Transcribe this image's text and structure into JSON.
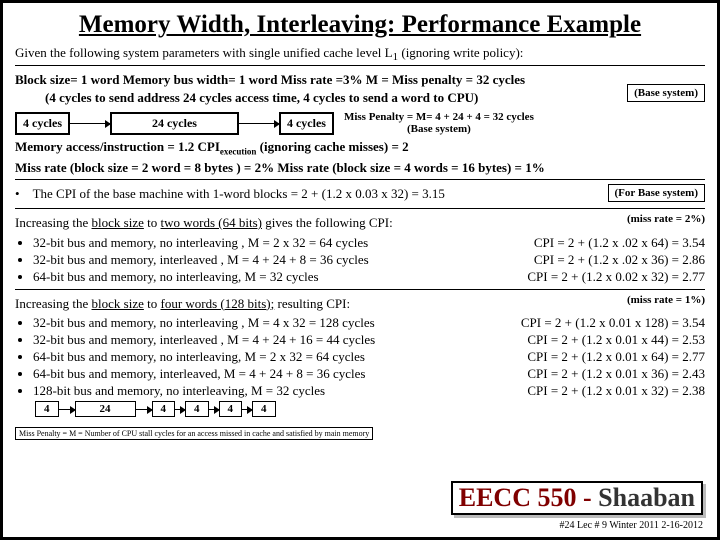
{
  "title": "Memory Width, Interleaving: Performance Example",
  "given": "Given the following system parameters with single unified cache level L",
  "given_sub": "1",
  "given_end": " (ignoring write policy):",
  "params1": "Block size= 1 word   Memory bus width= 1  word    Miss rate =3%   M = Miss penalty = 32 cycles",
  "params2": "(4 cycles to send address       24 cycles  access time,    4 cycles to send a word to CPU)",
  "base_sys": "(Base system)",
  "c4": "4 cycles",
  "c24": "24 cycles",
  "miss_eq": "Miss Penalty = M= 4 + 24 + 4 = 32 cycles",
  "mem_acc": "Memory access/instruction = 1.2         CPI",
  "cpi_sub": "execution",
  "cpi_txt": " (ignoring cache misses) = 2",
  "miss_rate": "Miss rate  (block size = 2 word = 8 bytes ) =  2%     Miss rate  (block size = 4 words = 16 bytes) = 1%",
  "cpi_base": "The CPI of the base machine with 1-word blocks  =  2 + (1.2 x 0.03 x 32) = 3.15",
  "for_base": "(For Base system)",
  "inc64_a": "Increasing the ",
  "inc64_b": "block size",
  "inc64_c": " to ",
  "inc64_d": "two words (64 bits)",
  "inc64_e": " gives the following CPI:",
  "mr2": "(miss rate = 2%)",
  "b64": [
    {
      "l": "32-bit bus and memory, no interleaving ,    M = 2 x 32 = 64 cycles",
      "r": "CPI = 2 + (1.2 x  .02 x 64) = 3.54"
    },
    {
      "l": "32-bit bus and memory, interleaved ,    M = 4 + 24 + 8   = 36 cycles",
      "r": "CPI = 2 + (1.2 x .02 x 36)  = 2.86"
    },
    {
      "l": "64-bit bus and memory, no interleaving,      M = 32 cycles",
      "r": "CPI = 2 + (1.2 x 0.02 x 32) = 2.77"
    }
  ],
  "inc128_a": "Increasing the ",
  "inc128_b": "block size",
  "inc128_c": " to ",
  "inc128_d": "four words (128 bits);",
  "inc128_e": " resulting CPI:",
  "mr1": "(miss rate = 1%)",
  "b128": [
    {
      "l": "32-bit bus and memory, no interleaving ,   M = 4 x 32 = 128 cycles",
      "r": "CPI = 2 + (1.2 x 0.01 x 128) = 3.54"
    },
    {
      "l": "32-bit bus and memory, interleaved ,   M = 4 + 24 + 16 = 44 cycles",
      "r": "CPI = 2 + (1.2 x 0.01 x 44)  = 2.53"
    },
    {
      "l": "64-bit bus and memory, no interleaving,   M =  2 x 32 =  64 cycles",
      "r": "CPI = 2 + (1.2 x 0.01 x 64) = 2.77"
    },
    {
      "l": "64-bit bus and memory, interleaved,    M = 4 + 24 +  8  = 36 cycles",
      "r": "CPI = 2 + (1.2 x 0.01 x 36)  = 2.43"
    },
    {
      "l": "128-bit bus and memory, no interleaving,    M =  32 cycles",
      "r": "CPI = 2 + (1.2 x 0.01 x 32) = 2.38"
    }
  ],
  "seq": [
    "4",
    "24",
    "4",
    "4",
    "4",
    "4"
  ],
  "foot": "Miss Penalty = M = Number of CPU stall cycles for an access missed in cache and satisfied by main memory",
  "course_a": "EECC 550 - ",
  "course_b": "Shaaban",
  "stamp": "#24  Lec # 9  Winter 2011  2-16-2012"
}
